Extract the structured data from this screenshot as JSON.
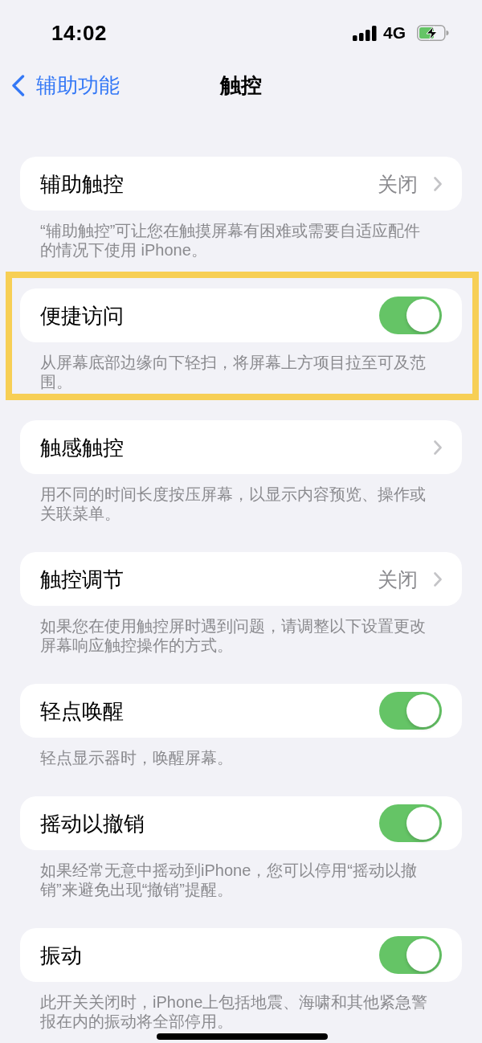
{
  "status_bar": {
    "time": "14:02",
    "network": "4G"
  },
  "nav": {
    "back_label": "辅助功能",
    "title": "触控"
  },
  "sections": [
    {
      "label": "辅助触控",
      "kind": "link",
      "value": "关闭",
      "footer": "“辅助触控”可让您在触摸屏幕有困难或需要自适应配件的情况下使用 iPhone。",
      "highlighted": false
    },
    {
      "label": "便捷访问",
      "kind": "toggle",
      "on": true,
      "footer": "从屏幕底部边缘向下轻扫，将屏幕上方项目拉至可及范围。",
      "highlighted": true
    },
    {
      "label": "触感触控",
      "kind": "link",
      "footer": "用不同的时间长度按压屏幕，以显示内容预览、操作或关联菜单。",
      "highlighted": false
    },
    {
      "label": "触控调节",
      "kind": "link",
      "value": "关闭",
      "footer": "如果您在使用触控屏时遇到问题，请调整以下设置更改屏幕响应触控操作的方式。",
      "highlighted": false
    },
    {
      "label": "轻点唤醒",
      "kind": "toggle",
      "on": true,
      "footer": "轻点显示器时，唤醒屏幕。",
      "highlighted": false
    },
    {
      "label": "摇动以撤销",
      "kind": "toggle",
      "on": true,
      "footer": "如果经常无意中摇动到iPhone，您可以停用“摇动以撤销”来避免出现“撤销”提醒。",
      "highlighted": false
    },
    {
      "label": "振动",
      "kind": "toggle",
      "on": true,
      "footer": "此开关关闭时，iPhone上包括地震、海啸和其他紧急警报在内的振动将全部停用。",
      "highlighted": false
    }
  ]
}
